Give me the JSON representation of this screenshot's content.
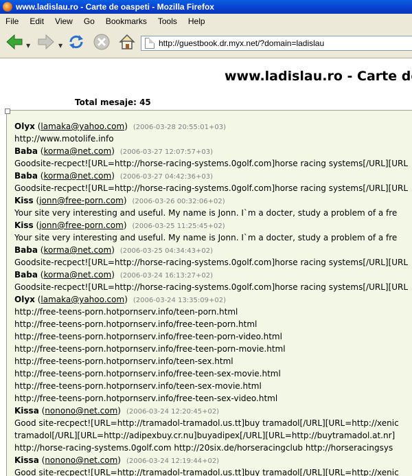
{
  "window": {
    "title": "www.ladislau.ro - Carte de oaspeti - Mozilla Firefox"
  },
  "menu": {
    "items": [
      "File",
      "Edit",
      "View",
      "Go",
      "Bookmarks",
      "Tools",
      "Help"
    ]
  },
  "toolbar": {
    "url": "http://guestbook.dr.myx.net/?domain=ladislau"
  },
  "page": {
    "title": "www.ladislau.ro - Carte de",
    "total": "Total mesaje: 45"
  },
  "entries": [
    {
      "name": "Olyx",
      "email": "lamaka@yahoo.com",
      "date": "(2006-03-28 20:55:01+03)",
      "lines": [
        "http://www.motolife.info"
      ]
    },
    {
      "name": "Baba",
      "email": "korma@net.com",
      "date": "(2006-03-27 12:07:57+03)",
      "lines": [
        "Goodsite-recpect![URL=http://horse-racing-systems.0golf.com]horse racing systems[/URL][URL"
      ]
    },
    {
      "name": "Baba",
      "email": "korma@net.com",
      "date": "(2006-03-27 04:42:36+03)",
      "lines": [
        "Goodsite-recpect![URL=http://horse-racing-systems.0golf.com]horse racing systems[/URL][URL"
      ]
    },
    {
      "name": "Kiss",
      "email": "jonn@free-porn.com",
      "date": "(2006-03-26 00:32:06+02)",
      "lines": [
        "Your site very interesting and useful. My name is Jonn. I`m a docter, study a problem of a fre"
      ]
    },
    {
      "name": "Kiss",
      "email": "jonn@free-porn.com",
      "date": "(2006-03-25 11:25:45+02)",
      "lines": [
        "Your site very interesting and useful. My name is Jonn. I`m a docter, study a problem of a fre"
      ]
    },
    {
      "name": "Baba",
      "email": "korma@net.com",
      "date": "(2006-03-25 04:34:43+02)",
      "lines": [
        "Goodsite-recpect![URL=http://horse-racing-systems.0golf.com]horse racing systems[/URL][URL"
      ]
    },
    {
      "name": "Baba",
      "email": "korma@net.com",
      "date": "(2006-03-24 16:13:27+02)",
      "lines": [
        "Goodsite-recpect![URL=http://horse-racing-systems.0golf.com]horse racing systems[/URL][URL"
      ]
    },
    {
      "name": "Olyx",
      "email": "lamaka@yahoo.com",
      "date": "(2006-03-24 13:35:09+02)",
      "lines": [
        "http://free-teens-porn.hotpornserv.info/teen-porn.html",
        "http://free-teens-porn.hotpornserv.info/free-teen-porn.html",
        "http://free-teens-porn.hotpornserv.info/free-teen-porn-video.html",
        "http://free-teens-porn.hotpornserv.info/free-teen-porn-movie.html",
        "http://free-teens-porn.hotpornserv.info/teen-sex.html",
        "http://free-teens-porn.hotpornserv.info/free-teen-sex-movie.html",
        "http://free-teens-porn.hotpornserv.info/teen-sex-movie.html",
        "http://free-teens-porn.hotpornserv.info/free-teen-sex-video.html"
      ]
    },
    {
      "name": "Kissa",
      "email": "nonono@net.com",
      "date": "(2006-03-24 12:20:45+02)",
      "lines": [
        "Good site-recpect![URL=http://tramadol-tramadol.us.tt]buy tramadol[/URL][URL=http://xenic",
        "tramadol[/URL][URL=http://adipexbuy.cr.nu]buyadipex[/URL][URL=http://buytramadol.at.nr]",
        "http://horse-racing-systems.0golf.com http://20six.de/horseracingclub http://horseracingsys"
      ]
    },
    {
      "name": "Kissa",
      "email": "nonono@net.com",
      "date": "(2006-03-24 12:19:44+02)",
      "lines": [
        "Good site-recpect![URL=http://tramadol-tramadol.us.tt]buy tramadol[/URL][URL=http://xenic"
      ]
    }
  ]
}
